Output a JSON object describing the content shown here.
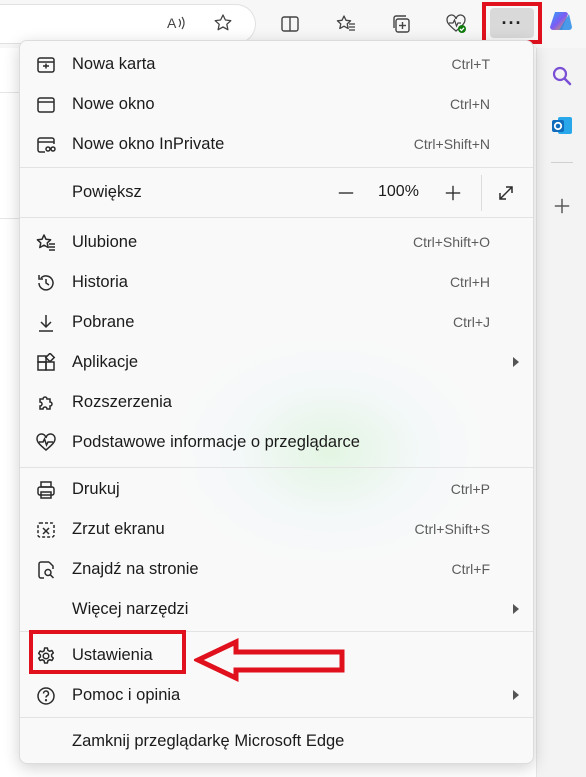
{
  "toolbar": {
    "icons": [
      "read-aloud-icon",
      "favorite-star-icon",
      "split-screen-icon",
      "favorites-icon",
      "collections-icon",
      "browser-essentials-icon",
      "more-icon"
    ],
    "more_label": "···"
  },
  "sidebar": {
    "icons": [
      "copilot-icon",
      "search-icon",
      "outlook-icon",
      "add-icon"
    ]
  },
  "menu": {
    "items": [
      {
        "label": "Nowa karta",
        "shortcut": "Ctrl+T",
        "icon": "new-tab-icon"
      },
      {
        "label": "Nowe okno",
        "shortcut": "Ctrl+N",
        "icon": "new-window-icon"
      },
      {
        "label": "Nowe okno InPrivate",
        "shortcut": "Ctrl+Shift+N",
        "icon": "inprivate-icon"
      },
      {
        "label": "Powiększ",
        "zoom_value": "100%"
      },
      {
        "label": "Ulubione",
        "shortcut": "Ctrl+Shift+O",
        "icon": "favorites-icon"
      },
      {
        "label": "Historia",
        "shortcut": "Ctrl+H",
        "icon": "history-icon"
      },
      {
        "label": "Pobrane",
        "shortcut": "Ctrl+J",
        "icon": "download-icon"
      },
      {
        "label": "Aplikacje",
        "icon": "apps-icon"
      },
      {
        "label": "Rozszerzenia",
        "icon": "extensions-icon"
      },
      {
        "label": "Podstawowe informacje o przeglądarce",
        "icon": "browser-essentials-icon"
      },
      {
        "label": "Drukuj",
        "shortcut": "Ctrl+P",
        "icon": "print-icon"
      },
      {
        "label": "Zrzut ekranu",
        "shortcut": "Ctrl+Shift+S",
        "icon": "screenshot-icon"
      },
      {
        "label": "Znajdź na stronie",
        "shortcut": "Ctrl+F",
        "icon": "find-icon"
      },
      {
        "label": "Więcej narzędzi"
      },
      {
        "label": "Ustawienia",
        "icon": "settings-icon"
      },
      {
        "label": "Pomoc i opinia",
        "icon": "help-icon"
      },
      {
        "label": "Zamknij przeglądarkę Microsoft Edge"
      }
    ]
  },
  "colors": {
    "annotation_red": "#e0101d",
    "menu_bg": "#f9f9f9",
    "accent_blue": "#0f6cbd"
  }
}
